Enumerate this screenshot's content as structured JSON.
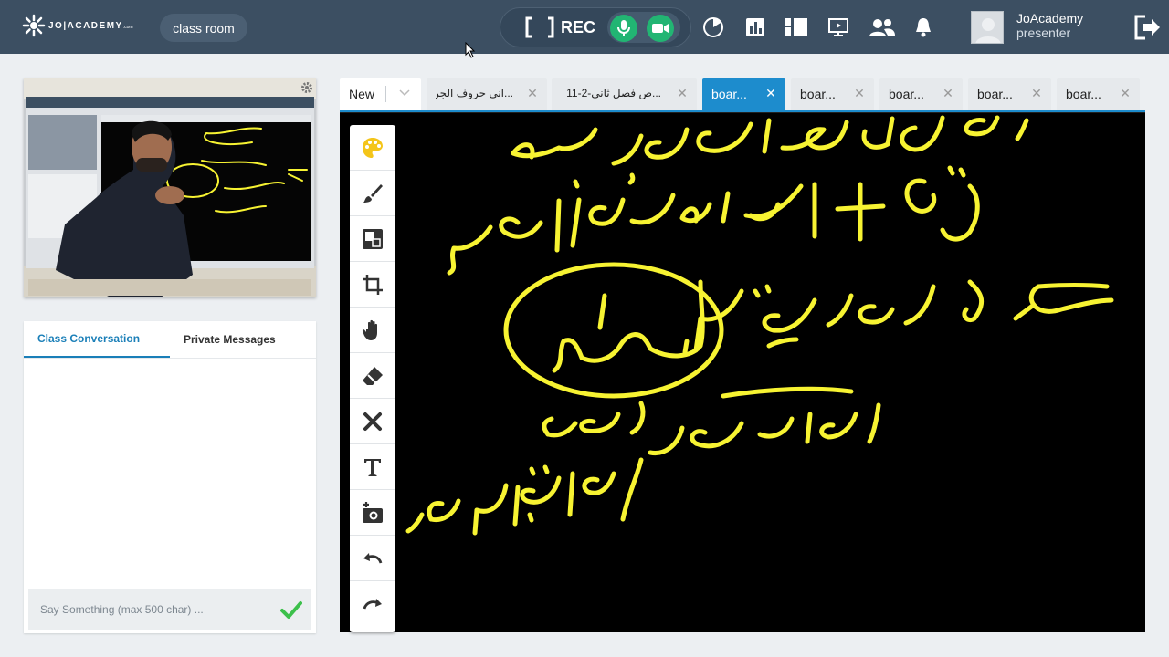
{
  "app": {
    "logo": "JO|ACADEMY",
    "logo_suffix": ".com",
    "room_label": "class room",
    "rec_label": "REC",
    "user_name": "JoAcademy",
    "user_role": "presenter"
  },
  "topbar_icons": [
    "record-bracket-icon",
    "microphone-icon",
    "camera-icon",
    "timer-icon",
    "poll-chart-icon",
    "layout-icon",
    "screen-share-icon",
    "participants-icon",
    "bell-icon",
    "exit-icon"
  ],
  "chat": {
    "tabs": [
      {
        "label": "Class Conversation",
        "active": true
      },
      {
        "label": "Private Messages",
        "active": false
      }
    ],
    "input_placeholder": "Say Something (max 500 char) ..."
  },
  "board_tabs": [
    {
      "label": "New",
      "kind": "new"
    },
    {
      "label": "...اني حروف الجر",
      "active": false
    },
    {
      "label": "...ص فصل ثاني-2-11",
      "active": false
    },
    {
      "label": "boar...",
      "active": true
    },
    {
      "label": "boar...",
      "active": false
    },
    {
      "label": "boar...",
      "active": false
    },
    {
      "label": "boar...",
      "active": false
    },
    {
      "label": "boar...",
      "active": false
    }
  ],
  "tools": [
    "palette-icon",
    "brush-icon",
    "fill-shape-icon",
    "crop-icon",
    "hand-icon",
    "eraser-icon",
    "clear-icon",
    "text-icon",
    "add-photo-icon",
    "undo-icon",
    "redo-icon"
  ],
  "colors": {
    "topbar": "#3c4f62",
    "accent": "#1d8ccd",
    "ink": "#f7f332",
    "green": "#22b573",
    "palette": "#f4c51a"
  }
}
